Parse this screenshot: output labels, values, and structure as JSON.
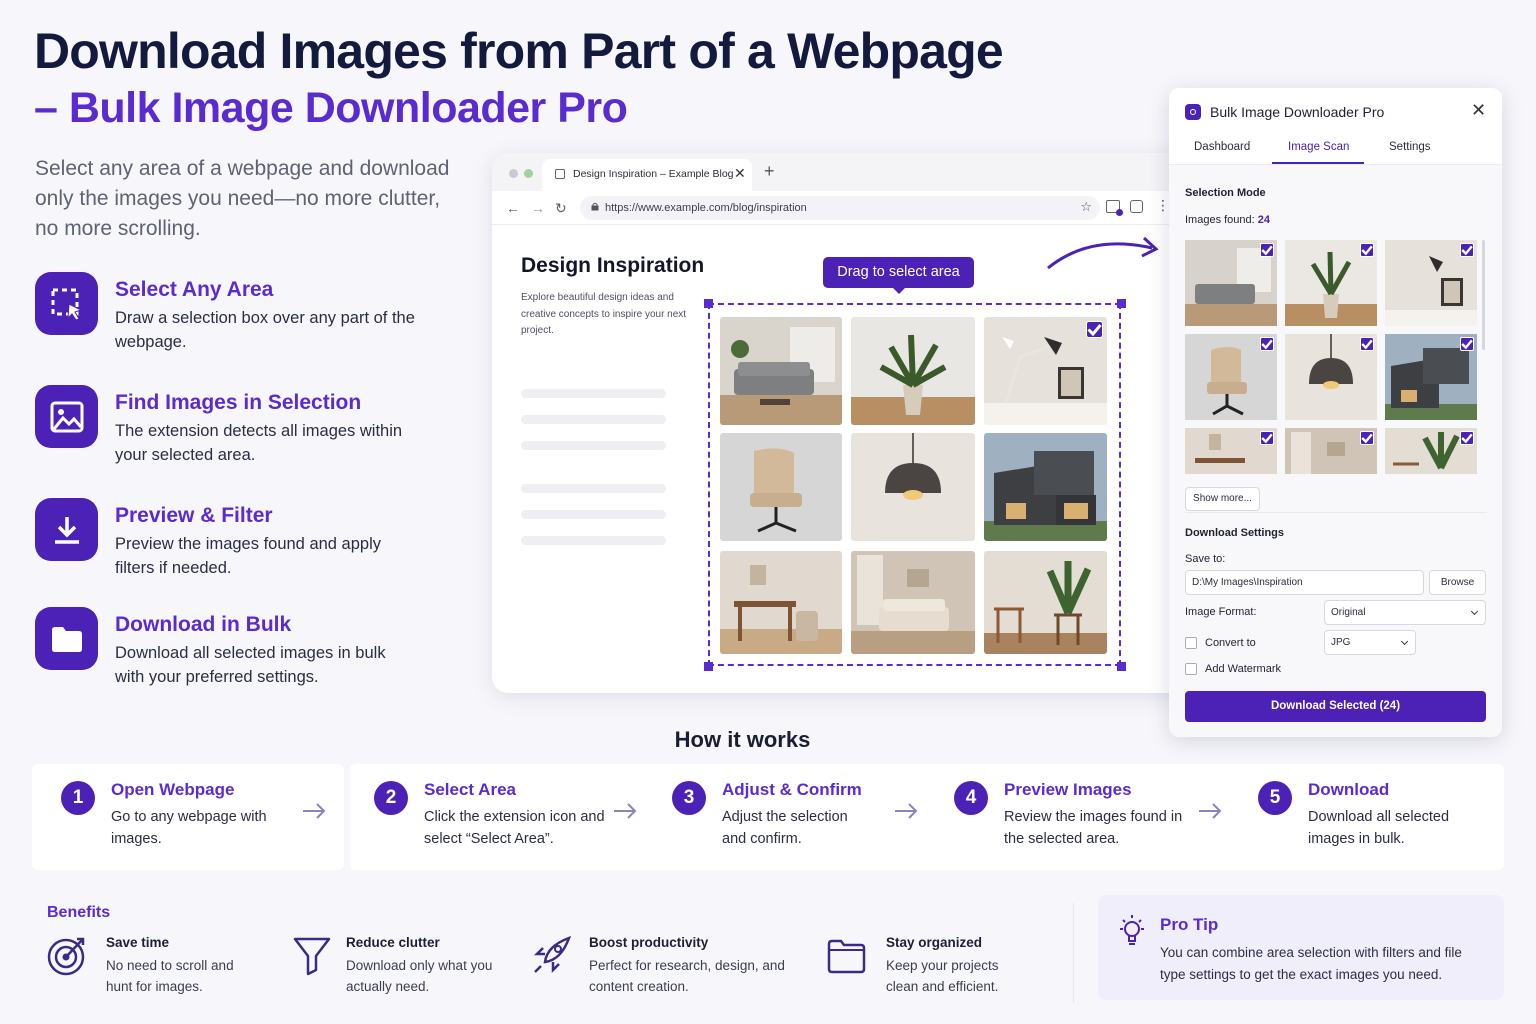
{
  "hero": {
    "title_line1": "Download Images from Part of a Webpage",
    "title_line2": "– Bulk Image Downloader Pro",
    "intro": "Select any area of a webpage and download only the images you need—no more clutter, no more scrolling."
  },
  "features": [
    {
      "title": "Select Any Area",
      "desc": "Draw a selection box over any part of the webpage.",
      "icon": "selection-cursor-icon"
    },
    {
      "title": "Find Images in Selection",
      "desc": "The extension detects all images within your selected area.",
      "icon": "image-icon"
    },
    {
      "title": "Preview & Filter",
      "desc": "Preview the images found and apply filters if needed.",
      "icon": "download-icon"
    },
    {
      "title": "Download in Bulk",
      "desc": "Download all selected images in bulk with your preferred settings.",
      "icon": "folder-icon"
    }
  ],
  "browser": {
    "tab_title": "Design Inspiration – Example Blog",
    "url": "https://www.example.com/blog/inspiration",
    "page_heading": "Design Inspiration",
    "page_text": "Explore beautiful design ideas and creative concepts to inspire your next project.",
    "tooltip": "Drag to select area"
  },
  "extension": {
    "title": "Bulk Image Downloader Pro",
    "tabs": [
      "Dashboard",
      "Image Scan",
      "Settings"
    ],
    "active_tab": "Image Scan",
    "selection_mode_label": "Selection Mode",
    "images_found_label": "Images found:",
    "images_found_count": "24",
    "show_more": "Show more...",
    "download_settings_label": "Download Settings",
    "save_to_label": "Save to:",
    "save_to_value": "D:\\My Images\\Inspiration",
    "browse_label": "Browse",
    "image_format_label": "Image Format:",
    "image_format_value": "Original",
    "convert_to_label": "Convert to",
    "convert_to_value": "JPG",
    "convert_checked": false,
    "watermark_label": "Add Watermark",
    "watermark_checked": false,
    "download_button": "Download Selected (24)"
  },
  "how_it_works": {
    "title": "How it works",
    "steps": [
      {
        "num": "1",
        "title": "Open Webpage",
        "desc": "Go to any webpage with images."
      },
      {
        "num": "2",
        "title": "Select Area",
        "desc": "Click the extension icon and select “Select Area”."
      },
      {
        "num": "3",
        "title": "Adjust & Confirm",
        "desc": "Adjust the selection and confirm."
      },
      {
        "num": "4",
        "title": "Preview Images",
        "desc": "Review the images found in the selected area."
      },
      {
        "num": "5",
        "title": "Download",
        "desc": "Download all selected images in bulk."
      }
    ]
  },
  "benefits": {
    "title": "Benefits",
    "items": [
      {
        "title": "Save time",
        "desc": "No need to scroll and hunt for images.",
        "icon": "target-icon"
      },
      {
        "title": "Reduce clutter",
        "desc": "Download only what you actually need.",
        "icon": "filter-icon"
      },
      {
        "title": "Boost productivity",
        "desc": "Perfect for research, design, and content creation.",
        "icon": "rocket-icon"
      },
      {
        "title": "Stay organized",
        "desc": "Keep your projects clean and efficient.",
        "icon": "folder-icon"
      }
    ]
  },
  "pro_tip": {
    "title": "Pro Tip",
    "text": "You can combine area selection with filters and file type settings to get the exact images you need.",
    "icon": "lightbulb-icon"
  },
  "colors": {
    "accent": "#4b21b6",
    "accent_text": "#5a2bd0",
    "heading": "#141a3d"
  }
}
